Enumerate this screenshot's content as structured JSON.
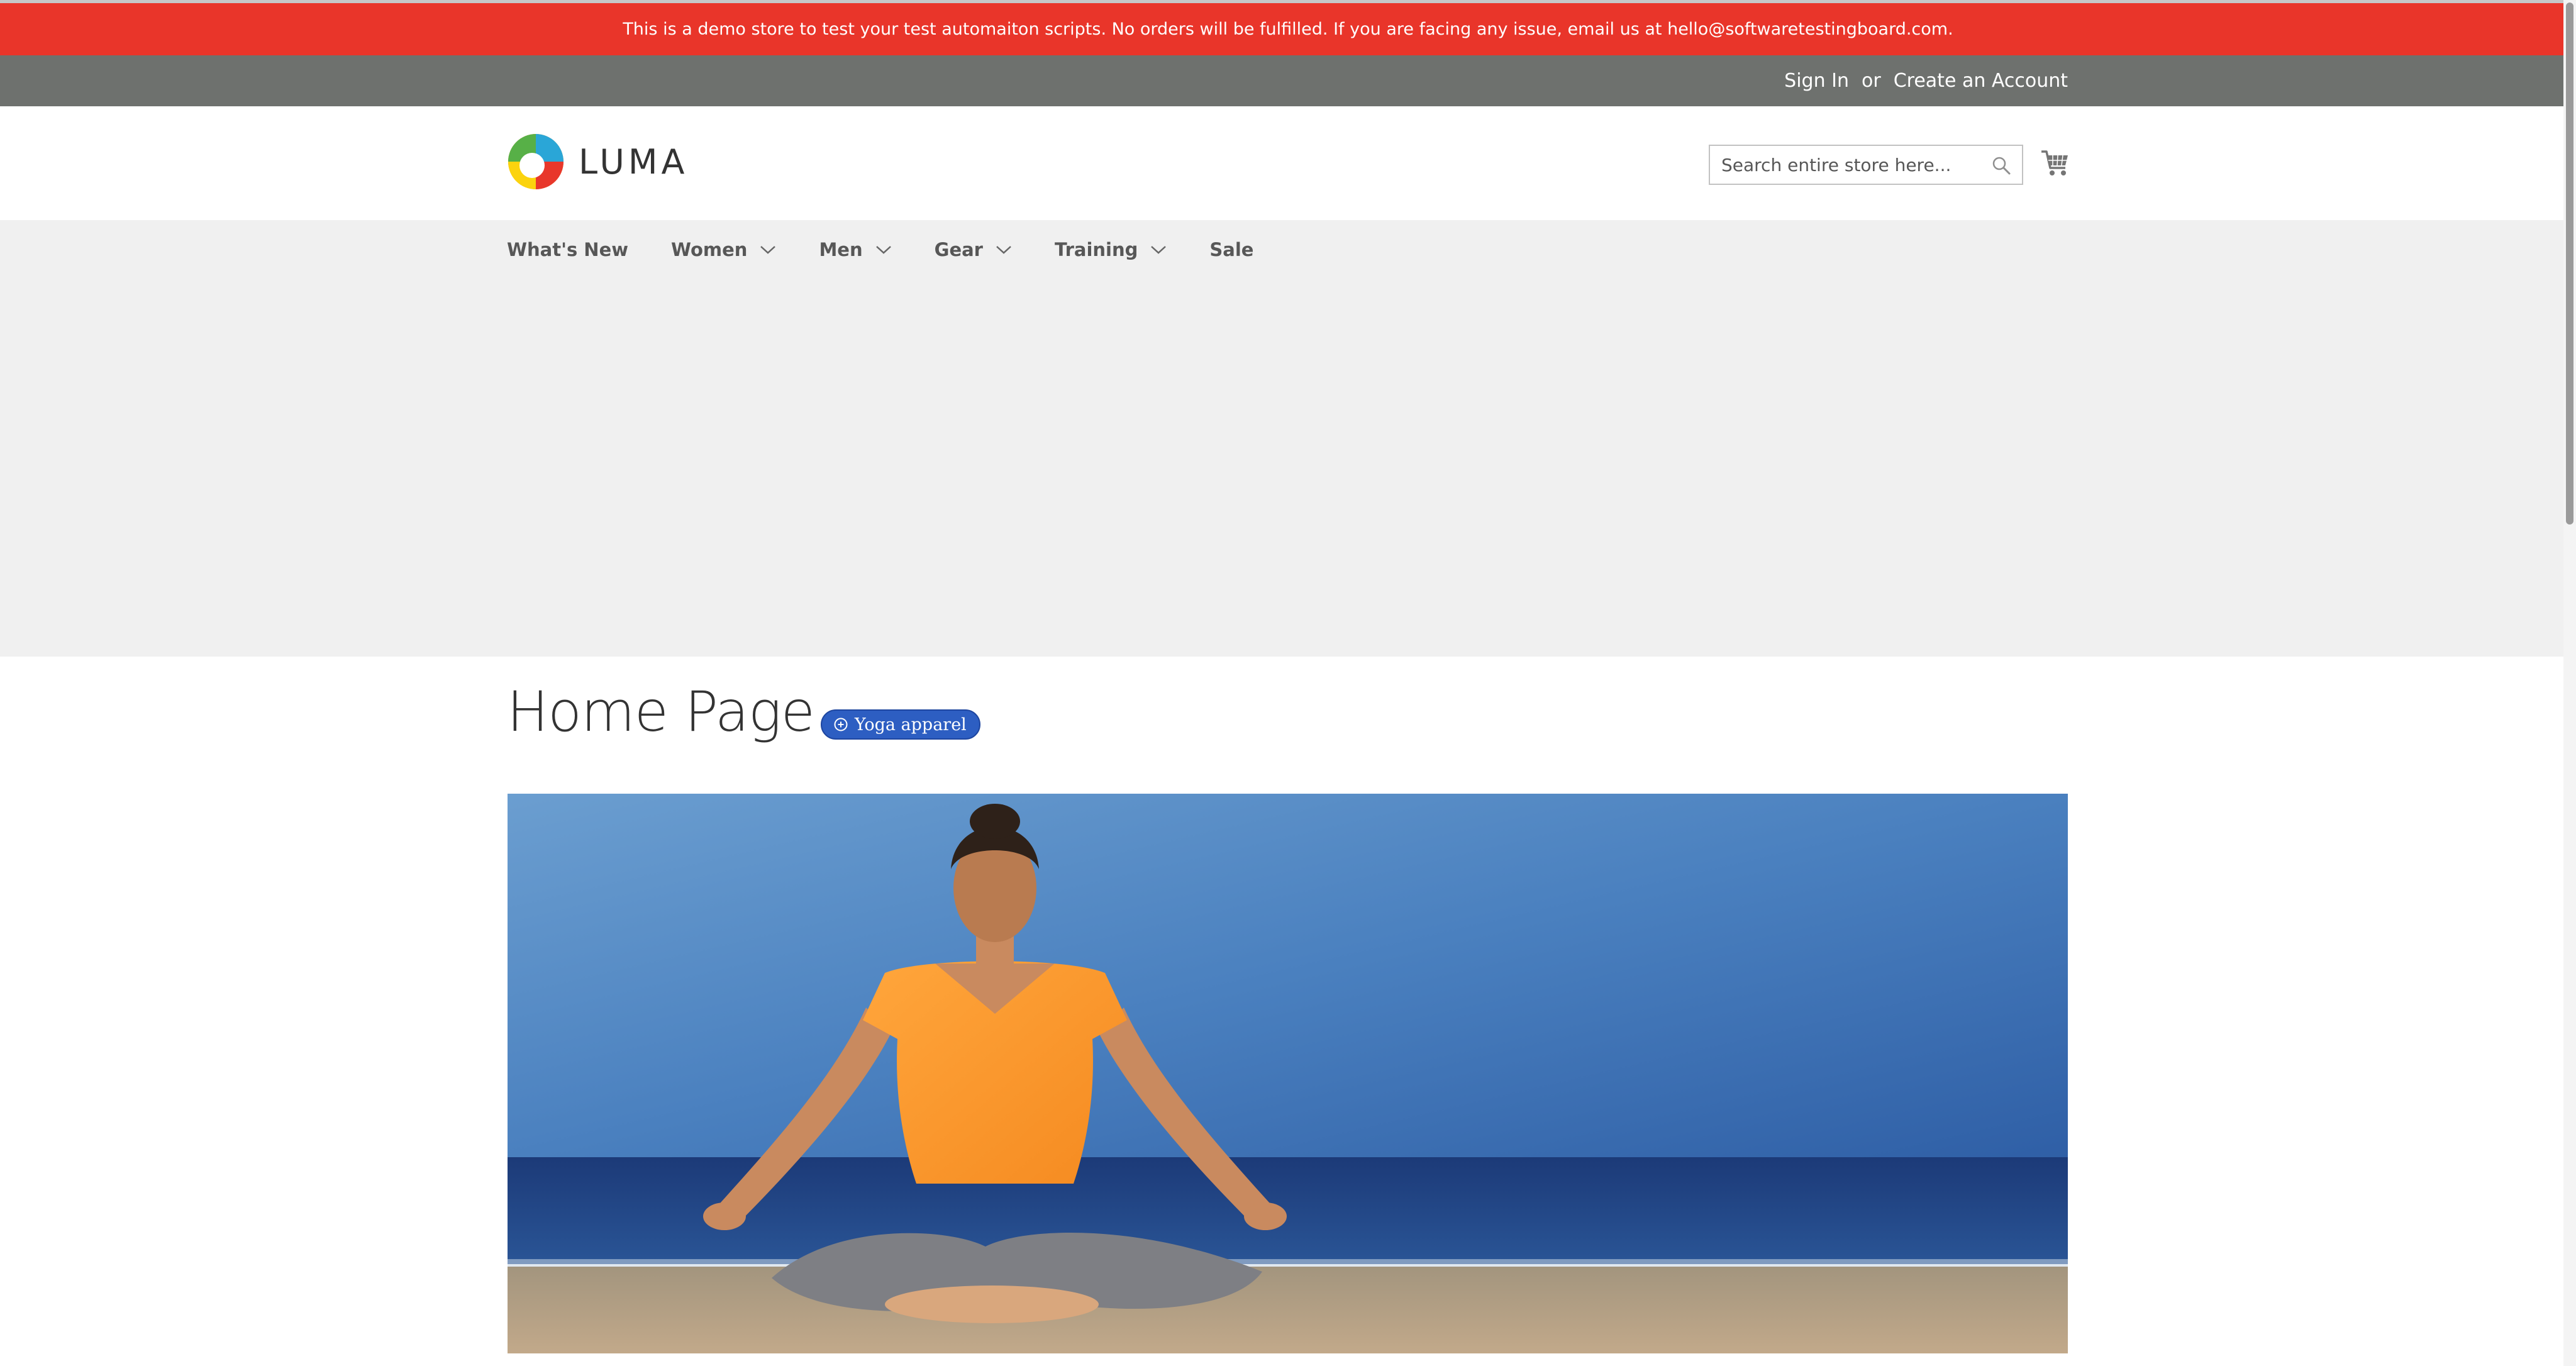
{
  "notice": {
    "text": "This is a demo store to test your test automaiton scripts. No orders will be fulfilled. If you are facing any issue, email us at hello@softwaretestingboard.com."
  },
  "header_links": {
    "sign_in": "Sign In",
    "or": "or",
    "create_account": "Create an Account"
  },
  "logo": {
    "text": "LUMA",
    "icon": "luma-logo-icon"
  },
  "search": {
    "placeholder": "Search entire store here...",
    "icon": "search-icon"
  },
  "cart": {
    "icon": "cart-icon"
  },
  "nav": {
    "items": [
      {
        "label": "What's New",
        "has_dropdown": false
      },
      {
        "label": "Women",
        "has_dropdown": true
      },
      {
        "label": "Men",
        "has_dropdown": true
      },
      {
        "label": "Gear",
        "has_dropdown": true
      },
      {
        "label": "Training",
        "has_dropdown": true
      },
      {
        "label": "Sale",
        "has_dropdown": false
      }
    ]
  },
  "page": {
    "title": "Home Page",
    "badge": {
      "label": "Yoga apparel",
      "icon": "plus-circle-icon"
    }
  },
  "hero": {
    "image": "woman-meditating-on-beach-image"
  },
  "colors": {
    "notice_bg": "#e9352a",
    "header_links_bg": "#6e716e",
    "nav_bg": "#f0f0f0",
    "badge_bg": "#2d5ec2"
  }
}
